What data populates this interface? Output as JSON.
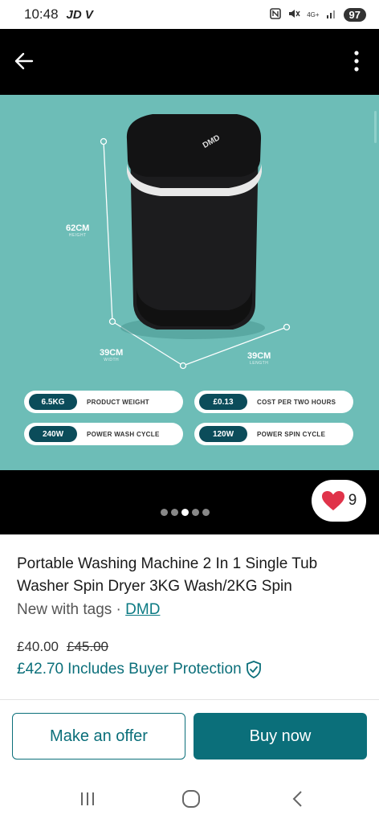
{
  "status_bar": {
    "time": "10:48",
    "carrier": "JD V",
    "network": "4G+",
    "battery": "97"
  },
  "top_bar": {
    "back_icon": "arrow-left-icon",
    "more_icon": "more-vertical-icon"
  },
  "hero": {
    "dimensions": {
      "height": "62CM",
      "height_sub": "HEIGHT",
      "width": "39CM",
      "width_sub": "WIDTH",
      "length": "39CM",
      "length_sub": "LENGTH"
    },
    "brand_logo": "DMD",
    "specs": [
      {
        "value": "6.5KG",
        "label": "PRODUCT WEIGHT"
      },
      {
        "value": "£0.13",
        "label": "COST PER TWO HOURS"
      },
      {
        "value": "240W",
        "label": "POWER WASH CYCLE"
      },
      {
        "value": "120W",
        "label": "POWER SPIN CYCLE"
      }
    ],
    "bg_color": "#6dbdb7"
  },
  "gallery": {
    "like_count": "9",
    "dot_count": 5,
    "active_dot": 3
  },
  "product": {
    "title": "Portable Washing Machine 2 In 1 Single Tub Washer Spin Dryer 3KG Wash/2KG Spin",
    "condition": "New with tags · ",
    "brand": "DMD",
    "price": "£40.00",
    "original_price": "£45.00",
    "total_price": "£42.70",
    "protection_text": "Includes Buyer Protection"
  },
  "actions": {
    "offer_label": "Make an offer",
    "buy_label": "Buy now"
  },
  "colors": {
    "accent": "#0b6f7a",
    "heart": "#e0334a"
  }
}
